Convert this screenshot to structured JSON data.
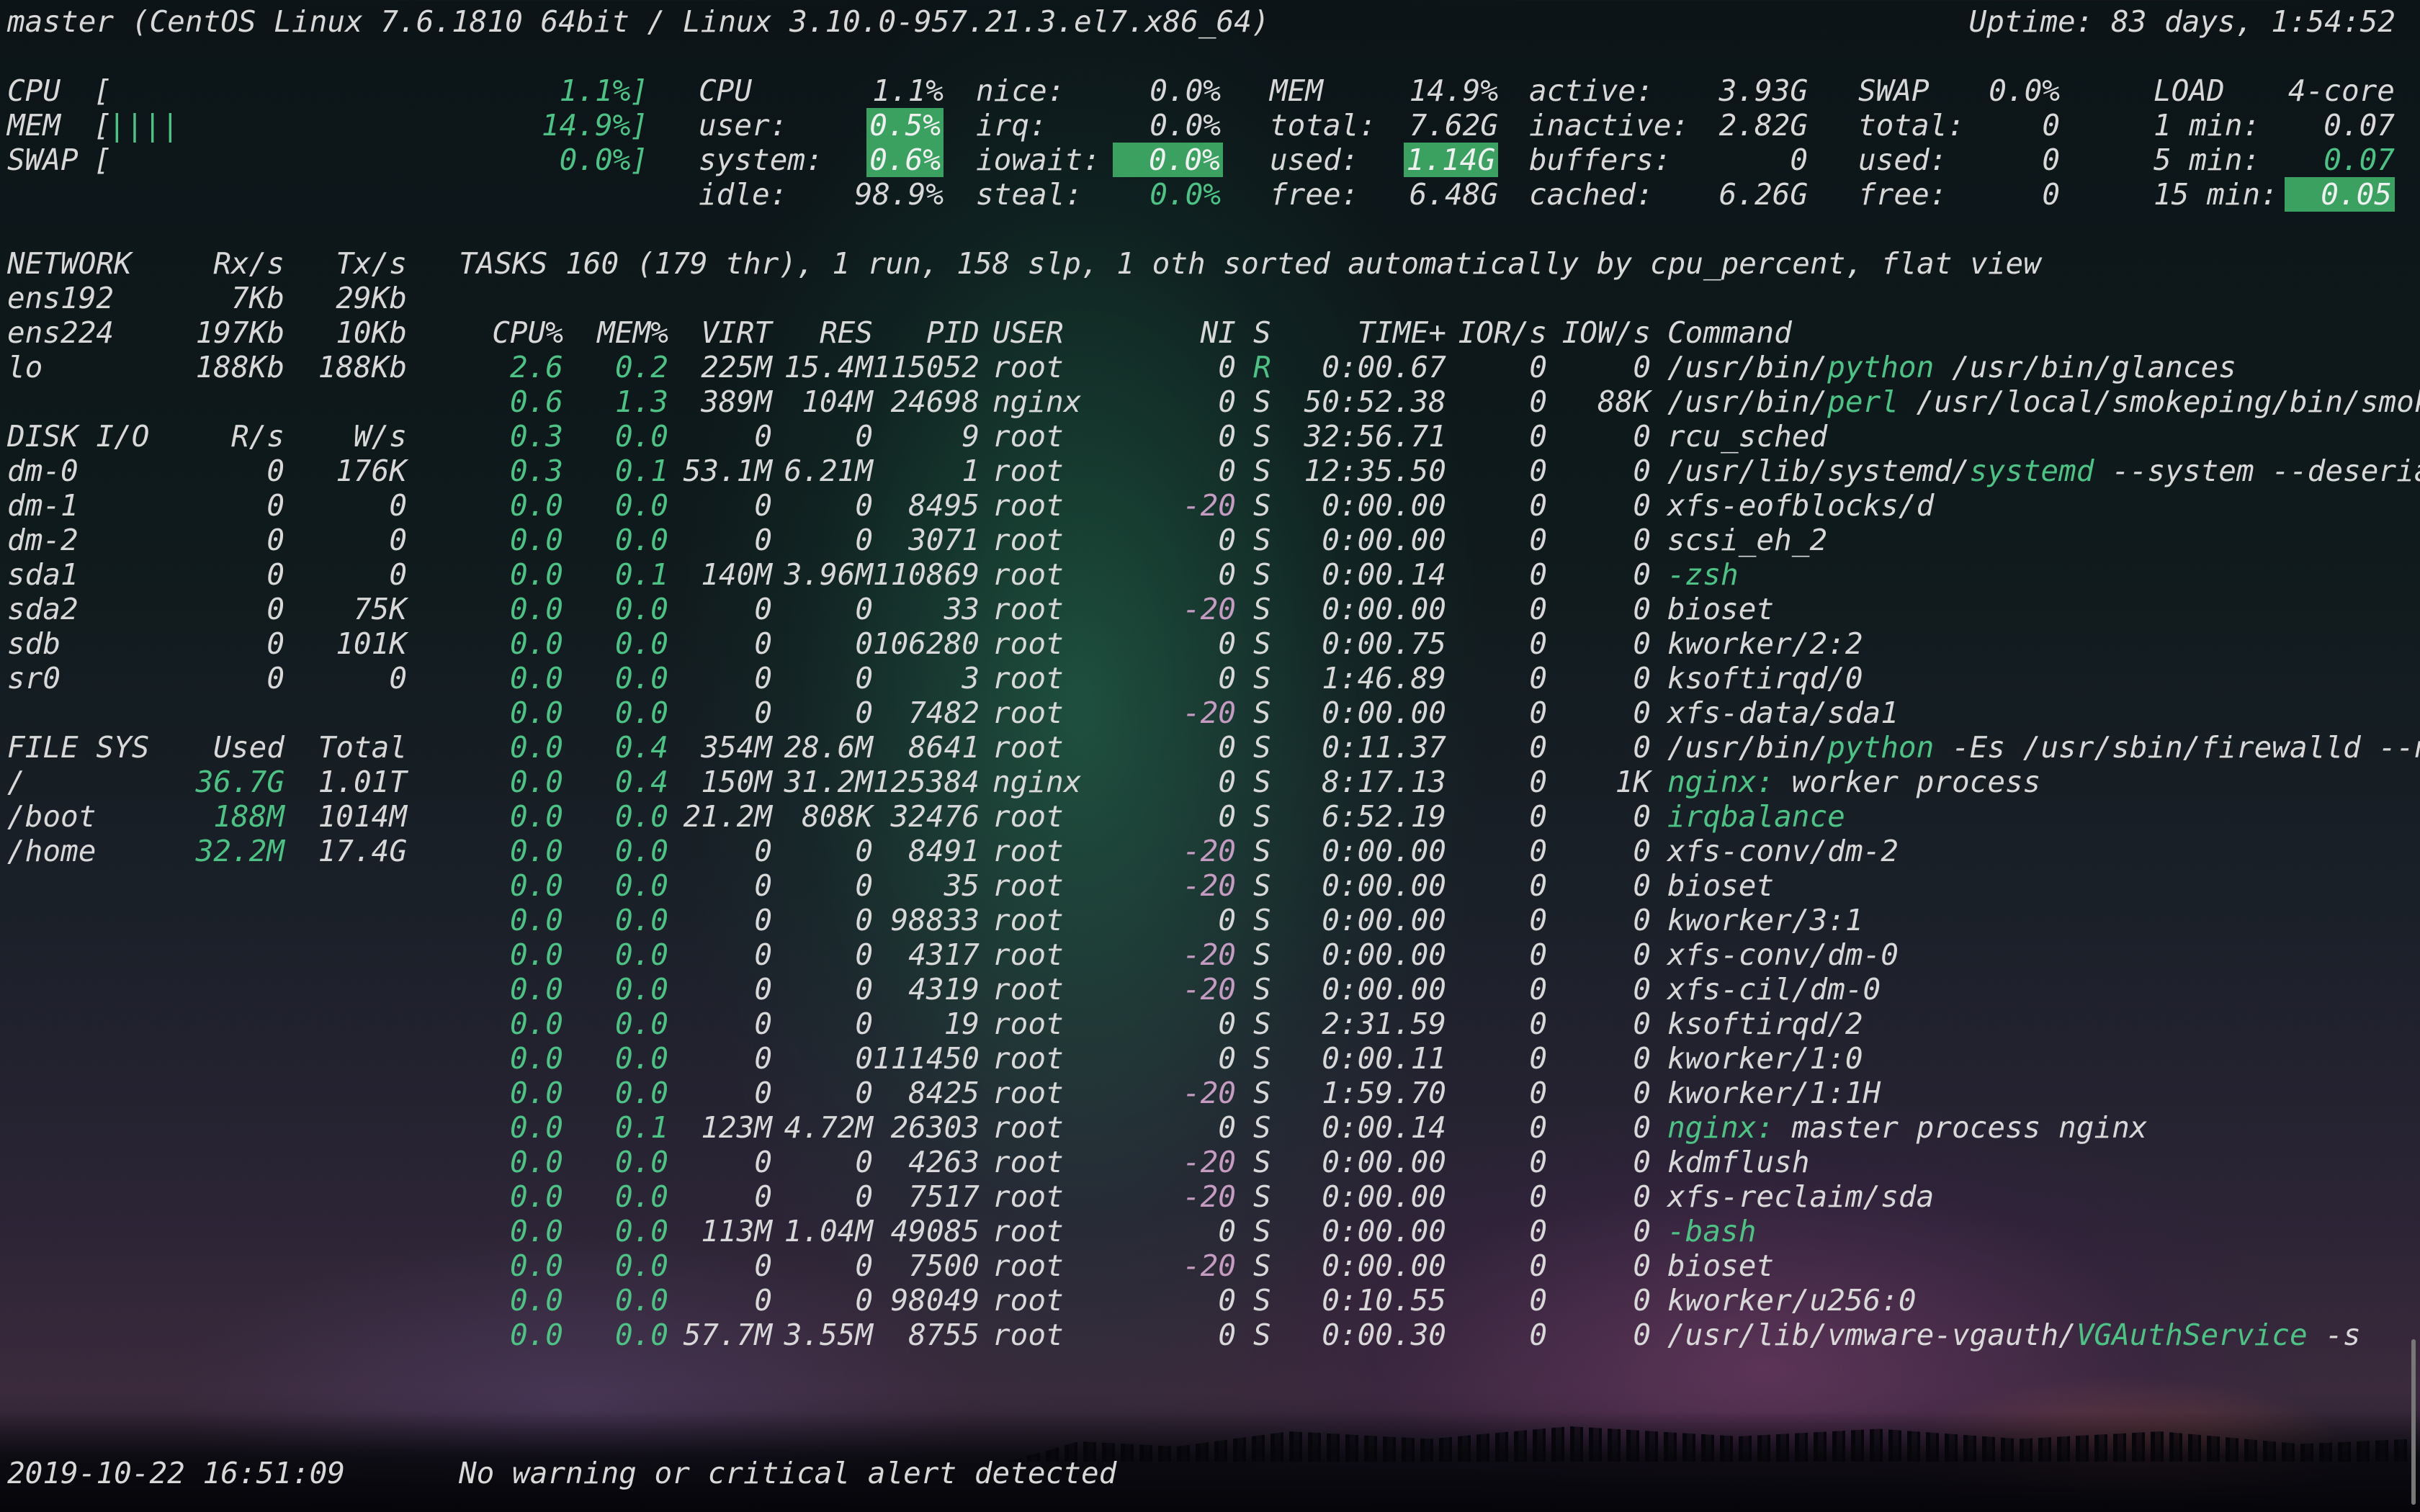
{
  "header": {
    "host_info": "master (CentOS Linux 7.6.1810 64bit / Linux 3.10.0-957.21.3.el7.x86_64)",
    "uptime": "Uptime: 83 days, 1:54:52"
  },
  "quicklook": {
    "cpu_label": "CPU",
    "cpu_bracket": "[",
    "cpu_bar": "",
    "cpu_value": "1.1%]",
    "mem_label": "MEM",
    "mem_bracket": "[",
    "mem_bar": "||||",
    "mem_value": "14.9%]",
    "swap_label": "SWAP",
    "swap_bracket": "[",
    "swap_bar": "",
    "swap_value": "0.0%]"
  },
  "cpu": {
    "title": "CPU",
    "total": "1.1%",
    "rows": [
      {
        "label": "user:",
        "value": "0.5%"
      },
      {
        "label": "system:",
        "value": "0.6%"
      },
      {
        "label": "idle:",
        "value": "98.9%"
      }
    ],
    "rows2": [
      {
        "label": "nice:",
        "value": "0.0%"
      },
      {
        "label": "irq:",
        "value": "0.0%"
      },
      {
        "label": "iowait:",
        "value": "0.0%"
      },
      {
        "label": "steal:",
        "value": "0.0%"
      }
    ]
  },
  "mem": {
    "title": "MEM",
    "percent": "14.9%",
    "rows": [
      {
        "label": "total:",
        "value": "7.62G"
      },
      {
        "label": "used:",
        "value": "1.14G"
      },
      {
        "label": "free:",
        "value": "6.48G"
      }
    ],
    "rows2": [
      {
        "label": "active:",
        "value": "3.93G"
      },
      {
        "label": "inactive:",
        "value": "2.82G"
      },
      {
        "label": "buffers:",
        "value": "0"
      },
      {
        "label": "cached:",
        "value": "6.26G"
      }
    ]
  },
  "swap": {
    "title": "SWAP",
    "percent": "0.0%",
    "rows": [
      {
        "label": "total:",
        "value": "0"
      },
      {
        "label": "used:",
        "value": "0"
      },
      {
        "label": "free:",
        "value": "0"
      }
    ]
  },
  "load": {
    "title": "LOAD",
    "cores": "4-core",
    "rows": [
      {
        "label": "1 min:",
        "value": "0.07"
      },
      {
        "label": "5 min:",
        "value": "0.07"
      },
      {
        "label": "15 min:",
        "value": "0.05"
      }
    ]
  },
  "network": {
    "title": "NETWORK",
    "rx_header": "Rx/s",
    "tx_header": "Tx/s",
    "rows": [
      {
        "name": "ens192",
        "rx": "7Kb",
        "tx": "29Kb"
      },
      {
        "name": "ens224",
        "rx": "197Kb",
        "tx": "10Kb"
      },
      {
        "name": "lo",
        "rx": "188Kb",
        "tx": "188Kb"
      }
    ]
  },
  "diskio": {
    "title": "DISK I/O",
    "r_header": "R/s",
    "w_header": "W/s",
    "rows": [
      {
        "name": "dm-0",
        "r": "0",
        "w": "176K"
      },
      {
        "name": "dm-1",
        "r": "0",
        "w": "0"
      },
      {
        "name": "dm-2",
        "r": "0",
        "w": "0"
      },
      {
        "name": "sda1",
        "r": "0",
        "w": "0"
      },
      {
        "name": "sda2",
        "r": "0",
        "w": "75K"
      },
      {
        "name": "sdb",
        "r": "0",
        "w": "101K"
      },
      {
        "name": "sr0",
        "r": "0",
        "w": "0"
      }
    ]
  },
  "filesys": {
    "title": "FILE SYS",
    "used_header": "Used",
    "total_header": "Total",
    "rows": [
      {
        "name": "/",
        "used": "36.7G",
        "total": "1.01T"
      },
      {
        "name": "/boot",
        "used": "188M",
        "total": "1014M"
      },
      {
        "name": "/home",
        "used": "32.2M",
        "total": "17.4G"
      }
    ]
  },
  "tasks": {
    "summary": "TASKS 160 (179 thr), 1 run, 158 slp, 1 oth sorted automatically by cpu_percent, flat view",
    "headers": {
      "cpu": "CPU%",
      "mem": "MEM%",
      "virt": "VIRT",
      "res": "RES",
      "pid": "PID",
      "user": "USER",
      "ni": "NI",
      "s": "S",
      "time": "TIME+",
      "ior": "IOR/s",
      "iow": "IOW/s",
      "cmd": "Command"
    }
  },
  "processes": [
    {
      "cpu": "2.6",
      "mem": "0.2",
      "virt": "225M",
      "res": "15.4M",
      "pid": "115052",
      "user": "root",
      "ni": "0",
      "s": "R",
      "time": "0:00.67",
      "ior": "0",
      "iow": "0",
      "cmd_pre": "/usr/bin/",
      "cmd_hl": "python",
      "cmd_post": " /usr/bin/glances"
    },
    {
      "cpu": "0.6",
      "mem": "1.3",
      "virt": "389M",
      "res": "104M",
      "pid": "24698",
      "user": "nginx",
      "ni": "0",
      "s": "S",
      "time": "50:52.38",
      "ior": "0",
      "iow": "88K",
      "cmd_pre": "/usr/bin/",
      "cmd_hl": "perl",
      "cmd_post": " /usr/local/smokeping/bin/smok"
    },
    {
      "cpu": "0.3",
      "mem": "0.0",
      "virt": "0",
      "res": "0",
      "pid": "9",
      "user": "root",
      "ni": "0",
      "s": "S",
      "time": "32:56.71",
      "ior": "0",
      "iow": "0",
      "cmd_pre": "rcu_sched",
      "cmd_hl": "",
      "cmd_post": ""
    },
    {
      "cpu": "0.3",
      "mem": "0.1",
      "virt": "53.1M",
      "res": "6.21M",
      "pid": "1",
      "user": "root",
      "ni": "0",
      "s": "S",
      "time": "12:35.50",
      "ior": "0",
      "iow": "0",
      "cmd_pre": "/usr/lib/systemd/",
      "cmd_hl": "systemd",
      "cmd_post": " --system --deseria"
    },
    {
      "cpu": "0.0",
      "mem": "0.0",
      "virt": "0",
      "res": "0",
      "pid": "8495",
      "user": "root",
      "ni": "-20",
      "s": "S",
      "time": "0:00.00",
      "ior": "0",
      "iow": "0",
      "cmd_pre": "xfs-eofblocks/d",
      "cmd_hl": "",
      "cmd_post": ""
    },
    {
      "cpu": "0.0",
      "mem": "0.0",
      "virt": "0",
      "res": "0",
      "pid": "3071",
      "user": "root",
      "ni": "0",
      "s": "S",
      "time": "0:00.00",
      "ior": "0",
      "iow": "0",
      "cmd_pre": "scsi_eh_2",
      "cmd_hl": "",
      "cmd_post": ""
    },
    {
      "cpu": "0.0",
      "mem": "0.1",
      "virt": "140M",
      "res": "3.96M",
      "pid": "110869",
      "user": "root",
      "ni": "0",
      "s": "S",
      "time": "0:00.14",
      "ior": "0",
      "iow": "0",
      "cmd_pre": "",
      "cmd_hl": "-zsh",
      "cmd_post": ""
    },
    {
      "cpu": "0.0",
      "mem": "0.0",
      "virt": "0",
      "res": "0",
      "pid": "33",
      "user": "root",
      "ni": "-20",
      "s": "S",
      "time": "0:00.00",
      "ior": "0",
      "iow": "0",
      "cmd_pre": "bioset",
      "cmd_hl": "",
      "cmd_post": ""
    },
    {
      "cpu": "0.0",
      "mem": "0.0",
      "virt": "0",
      "res": "0",
      "pid": "106280",
      "user": "root",
      "ni": "0",
      "s": "S",
      "time": "0:00.75",
      "ior": "0",
      "iow": "0",
      "cmd_pre": "kworker/2:2",
      "cmd_hl": "",
      "cmd_post": ""
    },
    {
      "cpu": "0.0",
      "mem": "0.0",
      "virt": "0",
      "res": "0",
      "pid": "3",
      "user": "root",
      "ni": "0",
      "s": "S",
      "time": "1:46.89",
      "ior": "0",
      "iow": "0",
      "cmd_pre": "ksoftirqd/0",
      "cmd_hl": "",
      "cmd_post": ""
    },
    {
      "cpu": "0.0",
      "mem": "0.0",
      "virt": "0",
      "res": "0",
      "pid": "7482",
      "user": "root",
      "ni": "-20",
      "s": "S",
      "time": "0:00.00",
      "ior": "0",
      "iow": "0",
      "cmd_pre": "xfs-data/sda1",
      "cmd_hl": "",
      "cmd_post": ""
    },
    {
      "cpu": "0.0",
      "mem": "0.4",
      "virt": "354M",
      "res": "28.6M",
      "pid": "8641",
      "user": "root",
      "ni": "0",
      "s": "S",
      "time": "0:11.37",
      "ior": "0",
      "iow": "0",
      "cmd_pre": "/usr/bin/",
      "cmd_hl": "python",
      "cmd_post": " -Es /usr/sbin/firewalld --n"
    },
    {
      "cpu": "0.0",
      "mem": "0.4",
      "virt": "150M",
      "res": "31.2M",
      "pid": "125384",
      "user": "nginx",
      "ni": "0",
      "s": "S",
      "time": "8:17.13",
      "ior": "0",
      "iow": "1K",
      "cmd_pre": "",
      "cmd_hl": "nginx:",
      "cmd_post": " worker process"
    },
    {
      "cpu": "0.0",
      "mem": "0.0",
      "virt": "21.2M",
      "res": "808K",
      "pid": "32476",
      "user": "root",
      "ni": "0",
      "s": "S",
      "time": "6:52.19",
      "ior": "0",
      "iow": "0",
      "cmd_pre": "",
      "cmd_hl": "irqbalance",
      "cmd_post": ""
    },
    {
      "cpu": "0.0",
      "mem": "0.0",
      "virt": "0",
      "res": "0",
      "pid": "8491",
      "user": "root",
      "ni": "-20",
      "s": "S",
      "time": "0:00.00",
      "ior": "0",
      "iow": "0",
      "cmd_pre": "xfs-conv/dm-2",
      "cmd_hl": "",
      "cmd_post": ""
    },
    {
      "cpu": "0.0",
      "mem": "0.0",
      "virt": "0",
      "res": "0",
      "pid": "35",
      "user": "root",
      "ni": "-20",
      "s": "S",
      "time": "0:00.00",
      "ior": "0",
      "iow": "0",
      "cmd_pre": "bioset",
      "cmd_hl": "",
      "cmd_post": ""
    },
    {
      "cpu": "0.0",
      "mem": "0.0",
      "virt": "0",
      "res": "0",
      "pid": "98833",
      "user": "root",
      "ni": "0",
      "s": "S",
      "time": "0:00.00",
      "ior": "0",
      "iow": "0",
      "cmd_pre": "kworker/3:1",
      "cmd_hl": "",
      "cmd_post": ""
    },
    {
      "cpu": "0.0",
      "mem": "0.0",
      "virt": "0",
      "res": "0",
      "pid": "4317",
      "user": "root",
      "ni": "-20",
      "s": "S",
      "time": "0:00.00",
      "ior": "0",
      "iow": "0",
      "cmd_pre": "xfs-conv/dm-0",
      "cmd_hl": "",
      "cmd_post": ""
    },
    {
      "cpu": "0.0",
      "mem": "0.0",
      "virt": "0",
      "res": "0",
      "pid": "4319",
      "user": "root",
      "ni": "-20",
      "s": "S",
      "time": "0:00.00",
      "ior": "0",
      "iow": "0",
      "cmd_pre": "xfs-cil/dm-0",
      "cmd_hl": "",
      "cmd_post": ""
    },
    {
      "cpu": "0.0",
      "mem": "0.0",
      "virt": "0",
      "res": "0",
      "pid": "19",
      "user": "root",
      "ni": "0",
      "s": "S",
      "time": "2:31.59",
      "ior": "0",
      "iow": "0",
      "cmd_pre": "ksoftirqd/2",
      "cmd_hl": "",
      "cmd_post": ""
    },
    {
      "cpu": "0.0",
      "mem": "0.0",
      "virt": "0",
      "res": "0",
      "pid": "111450",
      "user": "root",
      "ni": "0",
      "s": "S",
      "time": "0:00.11",
      "ior": "0",
      "iow": "0",
      "cmd_pre": "kworker/1:0",
      "cmd_hl": "",
      "cmd_post": ""
    },
    {
      "cpu": "0.0",
      "mem": "0.0",
      "virt": "0",
      "res": "0",
      "pid": "8425",
      "user": "root",
      "ni": "-20",
      "s": "S",
      "time": "1:59.70",
      "ior": "0",
      "iow": "0",
      "cmd_pre": "kworker/1:1H",
      "cmd_hl": "",
      "cmd_post": ""
    },
    {
      "cpu": "0.0",
      "mem": "0.1",
      "virt": "123M",
      "res": "4.72M",
      "pid": "26303",
      "user": "root",
      "ni": "0",
      "s": "S",
      "time": "0:00.14",
      "ior": "0",
      "iow": "0",
      "cmd_pre": "",
      "cmd_hl": "nginx:",
      "cmd_post": " master process nginx"
    },
    {
      "cpu": "0.0",
      "mem": "0.0",
      "virt": "0",
      "res": "0",
      "pid": "4263",
      "user": "root",
      "ni": "-20",
      "s": "S",
      "time": "0:00.00",
      "ior": "0",
      "iow": "0",
      "cmd_pre": "kdmflush",
      "cmd_hl": "",
      "cmd_post": ""
    },
    {
      "cpu": "0.0",
      "mem": "0.0",
      "virt": "0",
      "res": "0",
      "pid": "7517",
      "user": "root",
      "ni": "-20",
      "s": "S",
      "time": "0:00.00",
      "ior": "0",
      "iow": "0",
      "cmd_pre": "xfs-reclaim/sda",
      "cmd_hl": "",
      "cmd_post": ""
    },
    {
      "cpu": "0.0",
      "mem": "0.0",
      "virt": "113M",
      "res": "1.04M",
      "pid": "49085",
      "user": "root",
      "ni": "0",
      "s": "S",
      "time": "0:00.00",
      "ior": "0",
      "iow": "0",
      "cmd_pre": "",
      "cmd_hl": "-bash",
      "cmd_post": ""
    },
    {
      "cpu": "0.0",
      "mem": "0.0",
      "virt": "0",
      "res": "0",
      "pid": "7500",
      "user": "root",
      "ni": "-20",
      "s": "S",
      "time": "0:00.00",
      "ior": "0",
      "iow": "0",
      "cmd_pre": "bioset",
      "cmd_hl": "",
      "cmd_post": ""
    },
    {
      "cpu": "0.0",
      "mem": "0.0",
      "virt": "0",
      "res": "0",
      "pid": "98049",
      "user": "root",
      "ni": "0",
      "s": "S",
      "time": "0:10.55",
      "ior": "0",
      "iow": "0",
      "cmd_pre": "kworker/u256:0",
      "cmd_hl": "",
      "cmd_post": ""
    },
    {
      "cpu": "0.0",
      "mem": "0.0",
      "virt": "57.7M",
      "res": "3.55M",
      "pid": "8755",
      "user": "root",
      "ni": "0",
      "s": "S",
      "time": "0:00.30",
      "ior": "0",
      "iow": "0",
      "cmd_pre": "/usr/lib/vmware-vgauth/",
      "cmd_hl": "VGAuthService",
      "cmd_post": " -s"
    }
  ],
  "footer": {
    "timestamp": "2019-10-22 16:51:09",
    "alert": "No warning or critical alert detected"
  },
  "colors": {
    "accent_green": "#4cc384",
    "highlight_bg": "#3aa160",
    "nice_pink": "#c59bc1",
    "text": "#d8d8d8"
  }
}
